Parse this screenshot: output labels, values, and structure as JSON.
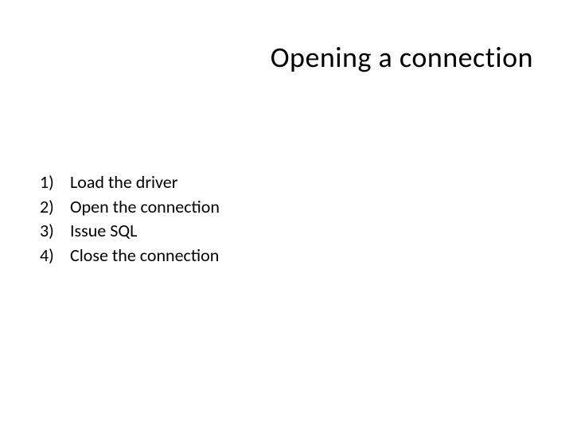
{
  "title": "Opening a connection",
  "items": [
    {
      "number": "1)",
      "text": "Load the driver"
    },
    {
      "number": "2)",
      "text": "Open the connection"
    },
    {
      "number": "3)",
      "text": "Issue SQL"
    },
    {
      "number": "4)",
      "text": "Close the connection"
    }
  ]
}
